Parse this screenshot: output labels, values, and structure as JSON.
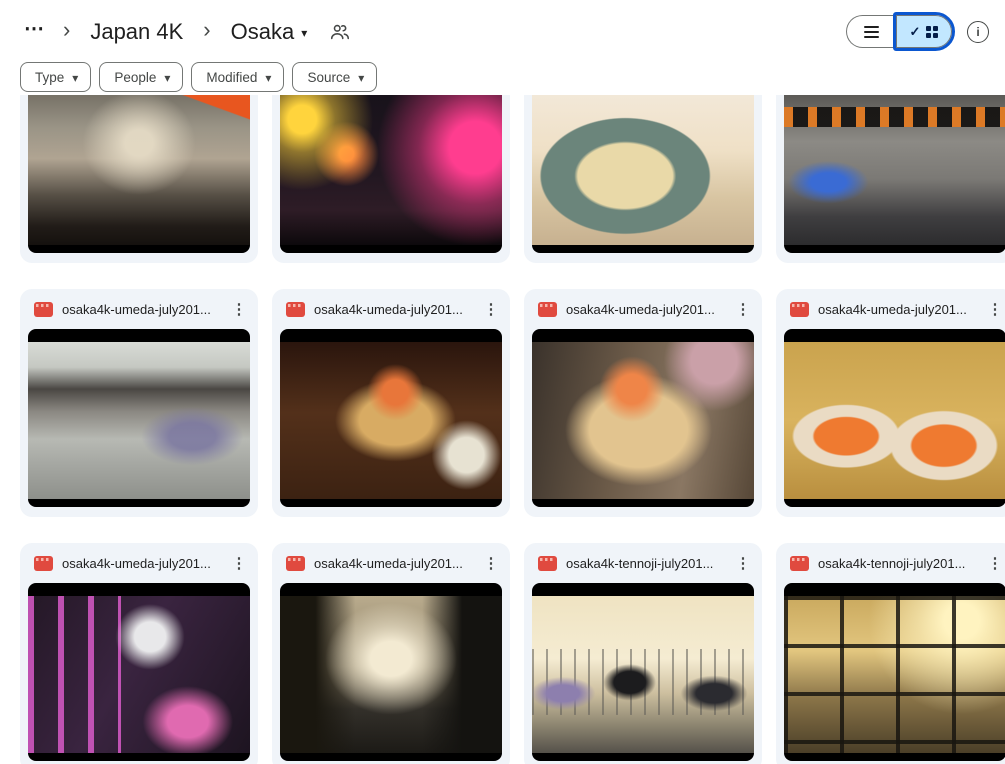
{
  "colors": {
    "accent_ring": "#0b57d0",
    "selected_view_bg": "#c2e7ff",
    "card_bg": "#f0f4f9",
    "chip_border": "#747775",
    "video_icon_red": "#e04a3f",
    "text_primary": "#1f1f1f",
    "text_secondary": "#444746"
  },
  "icons": {
    "more": "⋯",
    "chevron": "›",
    "caret": "▾",
    "menu": "⋮",
    "check": "✓",
    "info": "i"
  },
  "breadcrumb": {
    "root": "Japan 4K",
    "current": "Osaka"
  },
  "filters": [
    {
      "label": "Type"
    },
    {
      "label": "People"
    },
    {
      "label": "Modified"
    },
    {
      "label": "Source"
    }
  ],
  "view_toggle": {
    "list_selected": false,
    "grid_selected": true
  },
  "files": [
    {
      "name": "",
      "scene": "shopping-arcade-crowd"
    },
    {
      "name": "",
      "scene": "neon-street-night"
    },
    {
      "name": "",
      "scene": "noodle-bowl"
    },
    {
      "name": "",
      "scene": "station-ticket-gates"
    },
    {
      "name": "osaka4k-umeda-july201...",
      "scene": "station-concourse"
    },
    {
      "name": "osaka4k-umeda-july201...",
      "scene": "seafood-tray"
    },
    {
      "name": "osaka4k-umeda-july201...",
      "scene": "wooden-bucket-seafood"
    },
    {
      "name": "osaka4k-umeda-july201...",
      "scene": "salmon-sashimi-dishes"
    },
    {
      "name": "osaka4k-umeda-july201...",
      "scene": "claw-machine"
    },
    {
      "name": "osaka4k-umeda-july201...",
      "scene": "city-street-dusk"
    },
    {
      "name": "osaka4k-tennoji-july201...",
      "scene": "pedestrian-bridge-sunset"
    },
    {
      "name": "osaka4k-tennoji-july201...",
      "scene": "sunset-window-grid"
    }
  ]
}
